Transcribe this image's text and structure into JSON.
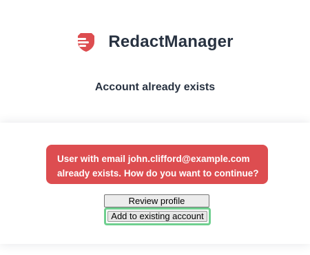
{
  "brand": {
    "name": "RedactManager",
    "logo_icon": "redactmanager-logo-icon",
    "logo_color": "#dd4d50"
  },
  "subtitle": "Account already exists",
  "alert": {
    "line1": "User with email john.clifford@example.com",
    "line2": "already exists. How do you want to continue?",
    "background": "#dd4d50"
  },
  "buttons": {
    "review_profile": "Review profile",
    "add_to_existing": "Add to existing account"
  },
  "colors": {
    "text": "#283241",
    "focus_ring": "#6fcf8f"
  }
}
